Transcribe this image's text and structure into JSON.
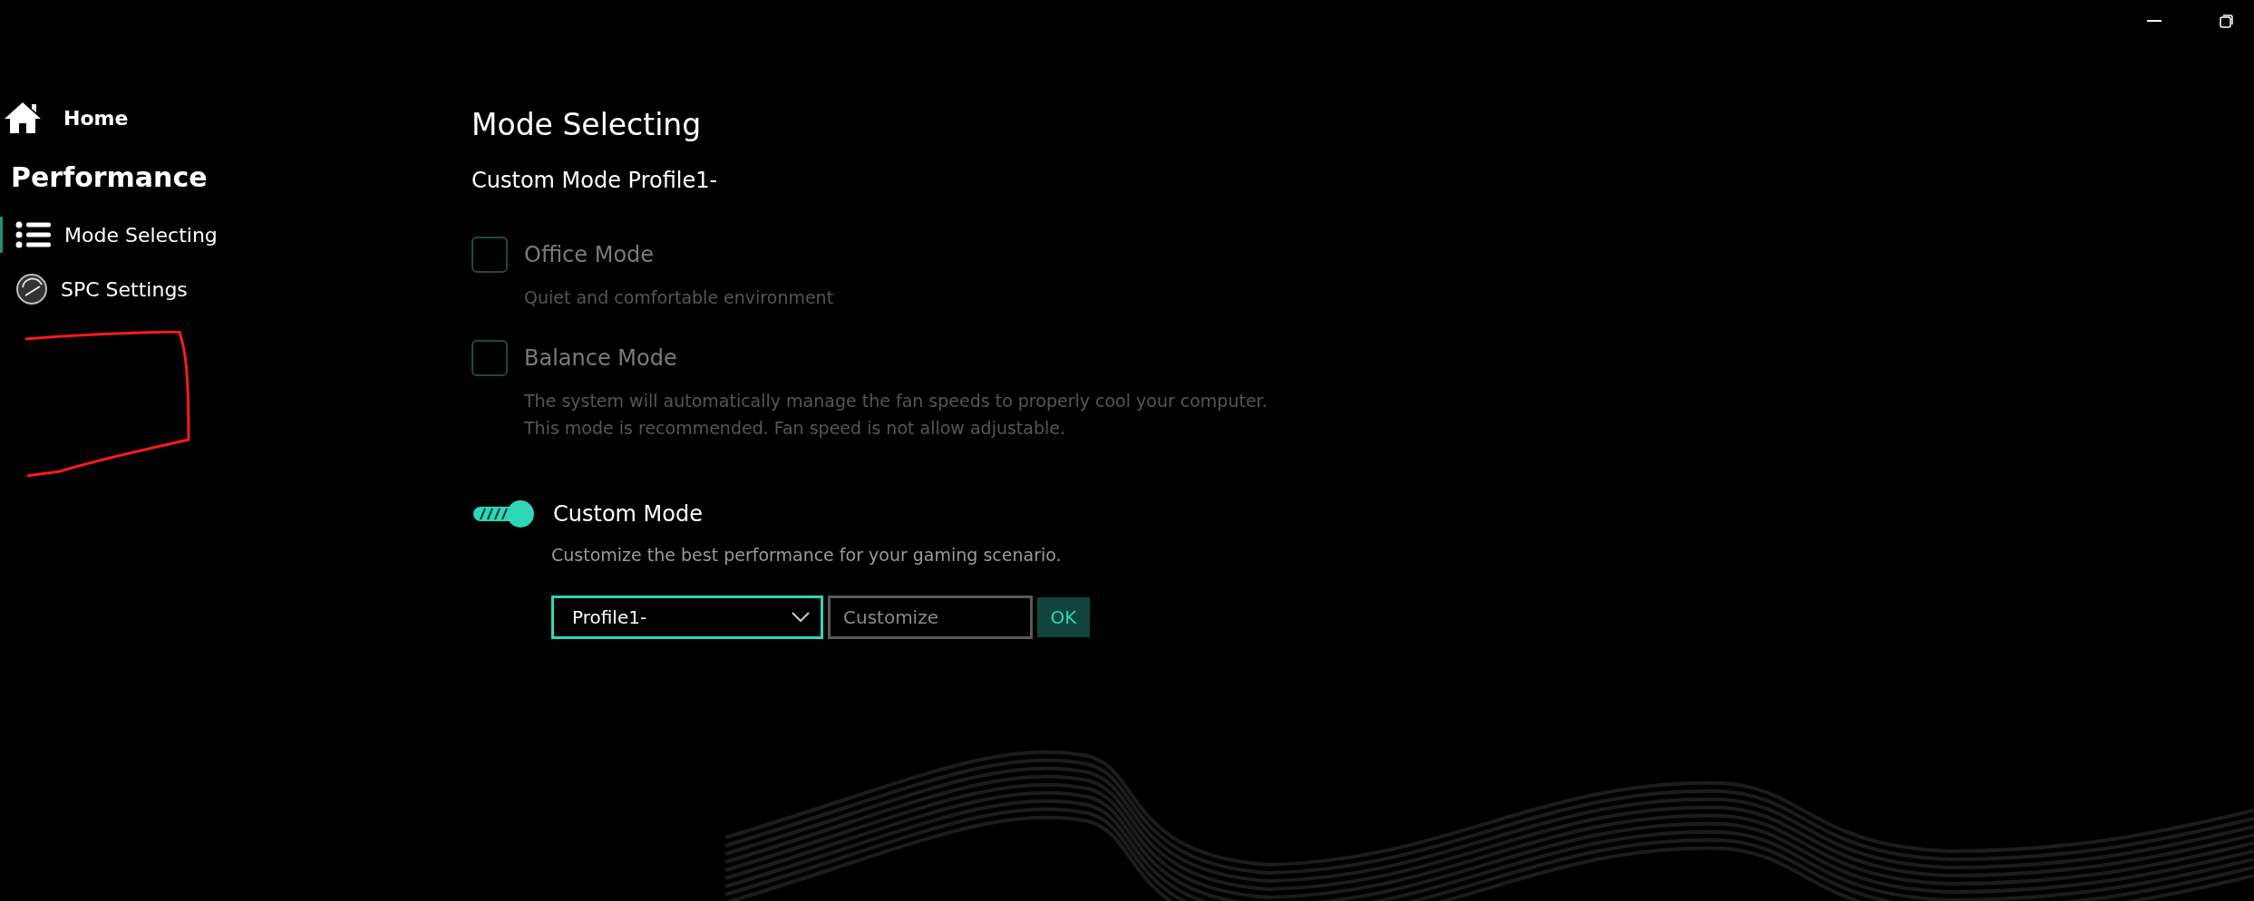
{
  "sidebar": {
    "home": "Home",
    "section": "Performance",
    "items": [
      {
        "label": "Mode Selecting",
        "selected": true
      },
      {
        "label": "SPC Settings",
        "selected": false
      }
    ]
  },
  "main": {
    "title": "Mode Selecting",
    "subtitle": "Custom Mode Profile1-",
    "modes": [
      {
        "kind": "checkbox",
        "label": "Office Mode",
        "checked": false,
        "description": [
          "Quiet and comfortable environment"
        ]
      },
      {
        "kind": "checkbox",
        "label": "Balance Mode",
        "checked": false,
        "description": [
          "The system will automatically manage the fan speeds to properly cool your computer.",
          "This mode is recommended. Fan speed is not allow adjustable."
        ]
      },
      {
        "kind": "toggle",
        "label": "Custom Mode",
        "on": true,
        "description": [
          "Customize the best performance for your gaming scenario."
        ]
      }
    ],
    "profile": {
      "value": "Profile1-",
      "placeholder": "Customize",
      "button": "OK"
    }
  }
}
